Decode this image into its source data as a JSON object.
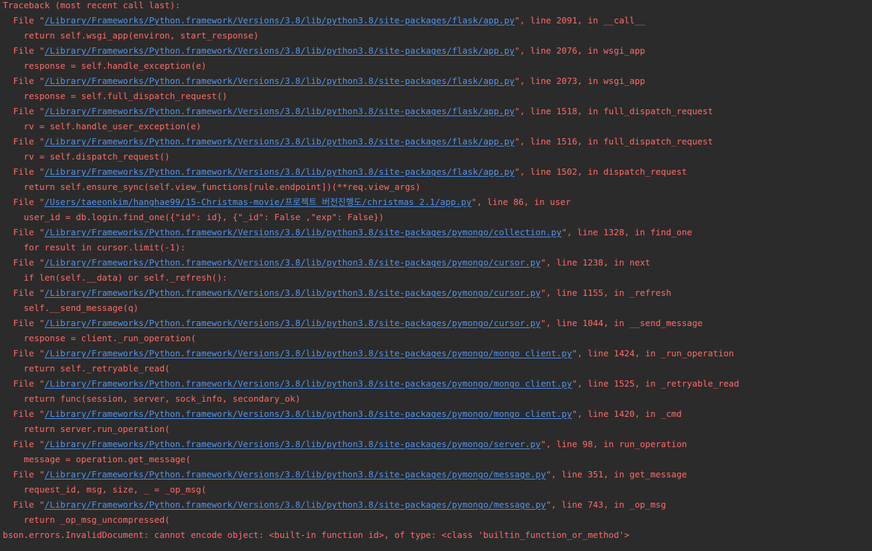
{
  "traceback": {
    "header": "Traceback (most recent call last):",
    "frames": [
      {
        "pre": "  File \"",
        "path": "/Library/Frameworks/Python.framework/Versions/3.8/lib/python3.8/site-packages/flask/app.py",
        "post": "\", line 2091, in __call__",
        "code": "    return self.wsgi_app(environ, start_response)"
      },
      {
        "pre": "  File \"",
        "path": "/Library/Frameworks/Python.framework/Versions/3.8/lib/python3.8/site-packages/flask/app.py",
        "post": "\", line 2076, in wsgi_app",
        "code": "    response = self.handle_exception(e)"
      },
      {
        "pre": "  File \"",
        "path": "/Library/Frameworks/Python.framework/Versions/3.8/lib/python3.8/site-packages/flask/app.py",
        "post": "\", line 2073, in wsgi_app",
        "code": "    response = self.full_dispatch_request()"
      },
      {
        "pre": "  File \"",
        "path": "/Library/Frameworks/Python.framework/Versions/3.8/lib/python3.8/site-packages/flask/app.py",
        "post": "\", line 1518, in full_dispatch_request",
        "code": "    rv = self.handle_user_exception(e)"
      },
      {
        "pre": "  File \"",
        "path": "/Library/Frameworks/Python.framework/Versions/3.8/lib/python3.8/site-packages/flask/app.py",
        "post": "\", line 1516, in full_dispatch_request",
        "code": "    rv = self.dispatch_request()"
      },
      {
        "pre": "  File \"",
        "path": "/Library/Frameworks/Python.framework/Versions/3.8/lib/python3.8/site-packages/flask/app.py",
        "post": "\", line 1502, in dispatch_request",
        "code": "    return self.ensure_sync(self.view_functions[rule.endpoint])(**req.view_args)"
      },
      {
        "pre": "  File \"",
        "path": "/Users/taeeonkim/hanghae99/15-Christmas-movie/프로젝트 버전진행도/christmas 2.1/app.py",
        "post": "\", line 86, in user",
        "code": "    user_id = db.login.find_one({\"id\": id}, {\"_id\": False ,\"exp\": False})"
      },
      {
        "pre": "  File \"",
        "path": "/Library/Frameworks/Python.framework/Versions/3.8/lib/python3.8/site-packages/pymongo/collection.py",
        "post": "\", line 1328, in find_one",
        "code": "    for result in cursor.limit(-1):"
      },
      {
        "pre": "  File \"",
        "path": "/Library/Frameworks/Python.framework/Versions/3.8/lib/python3.8/site-packages/pymongo/cursor.py",
        "post": "\", line 1238, in next",
        "code": "    if len(self.__data) or self._refresh():"
      },
      {
        "pre": "  File \"",
        "path": "/Library/Frameworks/Python.framework/Versions/3.8/lib/python3.8/site-packages/pymongo/cursor.py",
        "post": "\", line 1155, in _refresh",
        "code": "    self.__send_message(q)"
      },
      {
        "pre": "  File \"",
        "path": "/Library/Frameworks/Python.framework/Versions/3.8/lib/python3.8/site-packages/pymongo/cursor.py",
        "post": "\", line 1044, in __send_message",
        "code": "    response = client._run_operation("
      },
      {
        "pre": "  File \"",
        "path": "/Library/Frameworks/Python.framework/Versions/3.8/lib/python3.8/site-packages/pymongo/mongo_client.py",
        "post": "\", line 1424, in _run_operation",
        "code": "    return self._retryable_read("
      },
      {
        "pre": "  File \"",
        "path": "/Library/Frameworks/Python.framework/Versions/3.8/lib/python3.8/site-packages/pymongo/mongo_client.py",
        "post": "\", line 1525, in _retryable_read",
        "code": "    return func(session, server, sock_info, secondary_ok)"
      },
      {
        "pre": "  File \"",
        "path": "/Library/Frameworks/Python.framework/Versions/3.8/lib/python3.8/site-packages/pymongo/mongo_client.py",
        "post": "\", line 1420, in _cmd",
        "code": "    return server.run_operation("
      },
      {
        "pre": "  File \"",
        "path": "/Library/Frameworks/Python.framework/Versions/3.8/lib/python3.8/site-packages/pymongo/server.py",
        "post": "\", line 98, in run_operation",
        "code": "    message = operation.get_message("
      },
      {
        "pre": "  File \"",
        "path": "/Library/Frameworks/Python.framework/Versions/3.8/lib/python3.8/site-packages/pymongo/message.py",
        "post": "\", line 351, in get_message",
        "code": "    request_id, msg, size, _ = _op_msg("
      },
      {
        "pre": "  File \"",
        "path": "/Library/Frameworks/Python.framework/Versions/3.8/lib/python3.8/site-packages/pymongo/message.py",
        "post": "\", line 743, in _op_msg",
        "code": "    return _op_msg_uncompressed("
      }
    ],
    "error": "bson.errors.InvalidDocument: cannot encode object: <built-in function id>, of type: <class 'builtin_function_or_method'>"
  },
  "colors": {
    "background": "#2b2b2b",
    "error_text": "#ff6b68",
    "link": "#5394ec"
  }
}
